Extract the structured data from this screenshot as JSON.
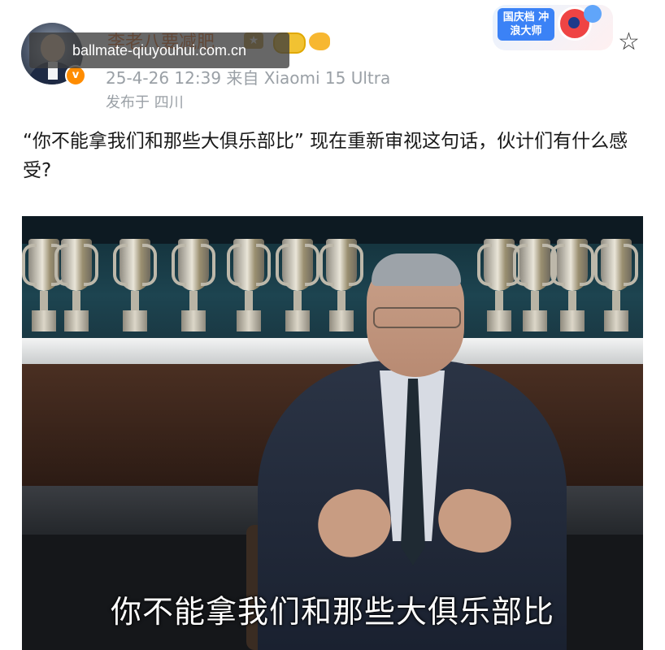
{
  "post": {
    "username": "李老八要减肥",
    "verified_badge": "v",
    "timestamp_device": "25-4-26 12:39 来自 Xiaomi 15 Ultra",
    "location": "发布于 四川",
    "text": "“你不能拿我们和那些大俱乐部比” 现在重新审视这句话，伙计们有什么感受?"
  },
  "watermark": "ballmate-qiuyouhui.com.cn",
  "event_badge": {
    "label": "国庆档 冲浪大师"
  },
  "icons": {
    "favorite": "star-outline-icon",
    "rank": "rank-badge-icon",
    "gold": "gold-coin-icon",
    "fish": "fish-icon"
  },
  "image": {
    "subtitle": "你不能拿我们和那些大俱乐部比"
  },
  "colors": {
    "username": "#e8742a",
    "meta": "#9aa0a6",
    "verified": "#ff8c00"
  }
}
